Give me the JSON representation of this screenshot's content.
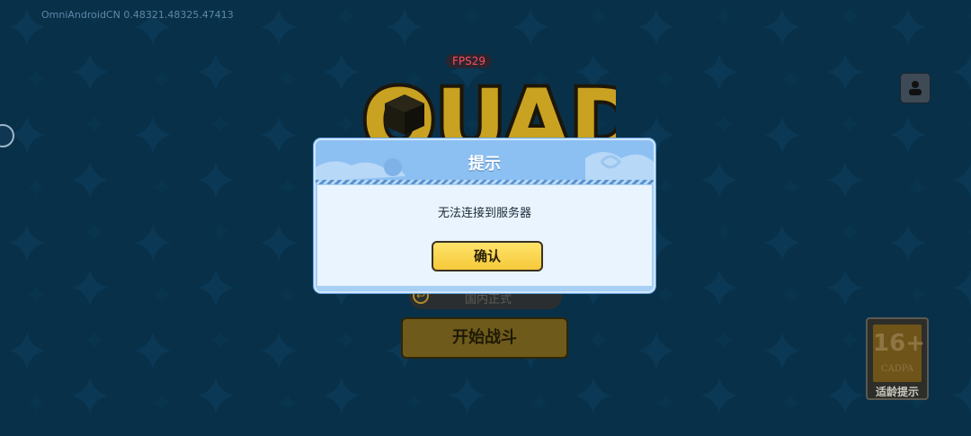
{
  "hud": {
    "version": "OmniAndroidCN 0.48321.48325.47413",
    "fps": "FPS29"
  },
  "logo": {
    "text": "QUAD"
  },
  "lobby": {
    "server_label": "国内正式",
    "start_label": "开始战斗"
  },
  "age_badge": {
    "number": "16+",
    "org": "CADPA",
    "caption": "适龄提示"
  },
  "dialog": {
    "title": "提示",
    "message": "无法连接到服务器",
    "confirm_label": "确认"
  },
  "colors": {
    "background": "#0b3c5a",
    "dialog_header": "#8dc0f2",
    "confirm_button": "#f6c93a",
    "fps_text": "#ff4d5a"
  },
  "icons": [
    "star-pattern",
    "cube-icon",
    "user-icon",
    "arrow-left-icon"
  ]
}
